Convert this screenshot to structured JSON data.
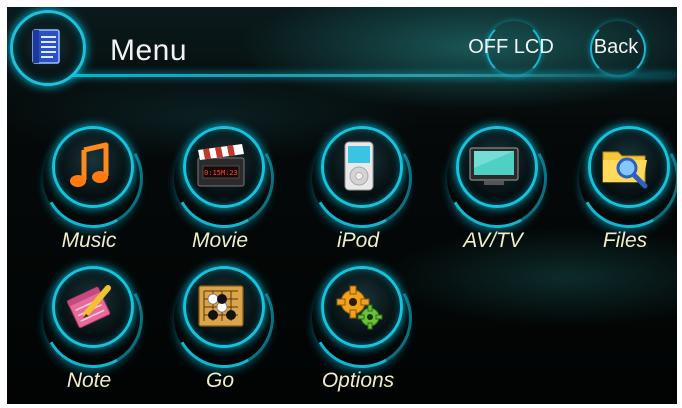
{
  "header": {
    "title": "Menu",
    "buttons": {
      "off_lcd": "OFF LCD",
      "back": "Back"
    }
  },
  "menu_items": [
    {
      "label": "Music",
      "icon": "music-note-icon"
    },
    {
      "label": "Movie",
      "icon": "clapperboard-icon"
    },
    {
      "label": "iPod",
      "icon": "ipod-icon"
    },
    {
      "label": "AV/TV",
      "icon": "tv-icon"
    },
    {
      "label": "Files",
      "icon": "folder-search-icon"
    },
    {
      "label": "Note",
      "icon": "notepad-pencil-icon"
    },
    {
      "label": "Go",
      "icon": "go-board-icon"
    },
    {
      "label": "Options",
      "icon": "gears-icon"
    }
  ],
  "movie_icon_display": "0:15M:23",
  "colors": {
    "accent": "#15c3dd",
    "label_text": "#f1edc8",
    "background": "#030606"
  }
}
